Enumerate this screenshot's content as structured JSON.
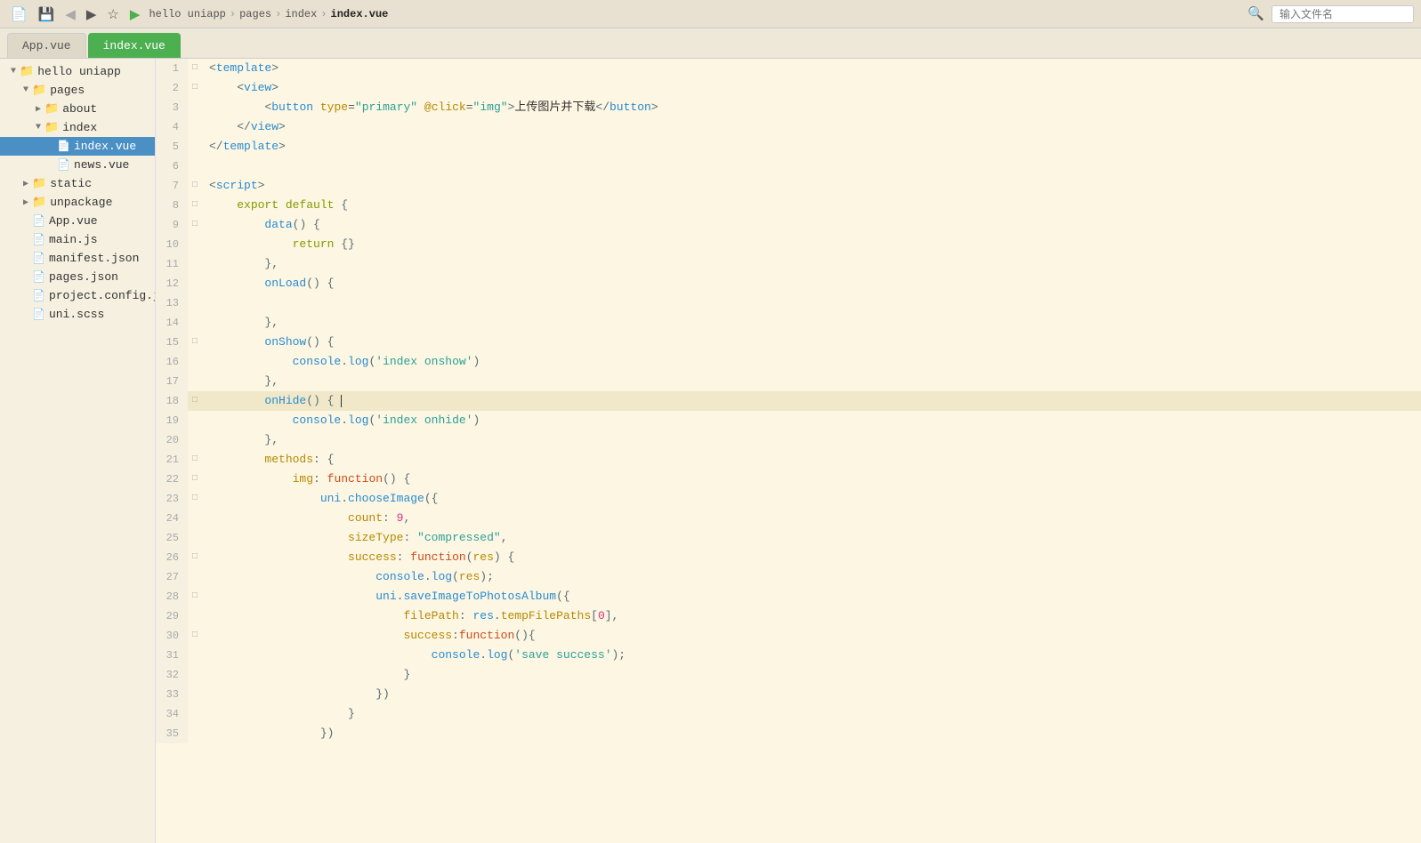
{
  "titlebar": {
    "breadcrumb": [
      "hello uniapp",
      "pages",
      "index",
      "index.vue"
    ],
    "search_placeholder": "输入文件名"
  },
  "tabs": [
    {
      "label": "App.vue",
      "active": false
    },
    {
      "label": "index.vue",
      "active": true
    }
  ],
  "sidebar": {
    "project": "hello uniapp",
    "tree": [
      {
        "id": "hello-uniapp",
        "label": "hello uniapp",
        "type": "project",
        "level": 0,
        "open": true
      },
      {
        "id": "pages",
        "label": "pages",
        "type": "folder",
        "level": 1,
        "open": true
      },
      {
        "id": "about",
        "label": "about",
        "type": "folder",
        "level": 2,
        "open": false
      },
      {
        "id": "index",
        "label": "index",
        "type": "folder",
        "level": 2,
        "open": true
      },
      {
        "id": "index-vue",
        "label": "index.vue",
        "type": "vue",
        "level": 3,
        "selected": true
      },
      {
        "id": "news-vue",
        "label": "news.vue",
        "type": "vue",
        "level": 3
      },
      {
        "id": "static",
        "label": "static",
        "type": "folder",
        "level": 1,
        "open": false
      },
      {
        "id": "unpackage",
        "label": "unpackage",
        "type": "folder",
        "level": 1,
        "open": false
      },
      {
        "id": "app-vue",
        "label": "App.vue",
        "type": "vue",
        "level": 1
      },
      {
        "id": "main-js",
        "label": "main.js",
        "type": "js",
        "level": 1
      },
      {
        "id": "manifest-json",
        "label": "manifest.json",
        "type": "json",
        "level": 1
      },
      {
        "id": "pages-json",
        "label": "pages.json",
        "type": "json-txt",
        "level": 1
      },
      {
        "id": "project-config",
        "label": "project.config.json",
        "type": "json-txt",
        "level": 1
      },
      {
        "id": "uni-css",
        "label": "uni.scss",
        "type": "css",
        "level": 1
      }
    ]
  },
  "code": {
    "lines": [
      {
        "num": 1,
        "fold": "open",
        "content": "<template>"
      },
      {
        "num": 2,
        "fold": "open",
        "content": "    <view>"
      },
      {
        "num": 3,
        "fold": "",
        "content": "        <button type=\"primary\" @click=\"img\">上传图片并下载</button>"
      },
      {
        "num": 4,
        "fold": "",
        "content": "    </view>"
      },
      {
        "num": 5,
        "fold": "",
        "content": "</template>"
      },
      {
        "num": 6,
        "fold": "",
        "content": ""
      },
      {
        "num": 7,
        "fold": "open",
        "content": "<script>"
      },
      {
        "num": 8,
        "fold": "open",
        "content": "    export default {"
      },
      {
        "num": 9,
        "fold": "open",
        "content": "        data() {"
      },
      {
        "num": 10,
        "fold": "",
        "content": "            return {}"
      },
      {
        "num": 11,
        "fold": "",
        "content": "        },"
      },
      {
        "num": 12,
        "fold": "",
        "content": "        onLoad() {"
      },
      {
        "num": 13,
        "fold": "",
        "content": ""
      },
      {
        "num": 14,
        "fold": "",
        "content": "        },"
      },
      {
        "num": 15,
        "fold": "open",
        "content": "        onShow() {"
      },
      {
        "num": 16,
        "fold": "",
        "content": "            console.log('index onshow')"
      },
      {
        "num": 17,
        "fold": "",
        "content": "        },"
      },
      {
        "num": 18,
        "fold": "open",
        "content": "        onHide() { ",
        "highlighted": true,
        "cursor": true
      },
      {
        "num": 19,
        "fold": "",
        "content": "            console.log('index onhide')"
      },
      {
        "num": 20,
        "fold": "",
        "content": "        },"
      },
      {
        "num": 21,
        "fold": "open",
        "content": "        methods: {"
      },
      {
        "num": 22,
        "fold": "open",
        "content": "            img: function() {"
      },
      {
        "num": 23,
        "fold": "open",
        "content": "                uni.chooseImage({"
      },
      {
        "num": 24,
        "fold": "",
        "content": "                    count: 9,"
      },
      {
        "num": 25,
        "fold": "",
        "content": "                    sizeType: \"compressed\","
      },
      {
        "num": 26,
        "fold": "open",
        "content": "                    success: function(res) {"
      },
      {
        "num": 27,
        "fold": "",
        "content": "                        console.log(res);"
      },
      {
        "num": 28,
        "fold": "open",
        "content": "                        uni.saveImageToPhotosAlbum({"
      },
      {
        "num": 29,
        "fold": "",
        "content": "                            filePath: res.tempFilePaths[0],"
      },
      {
        "num": 30,
        "fold": "open",
        "content": "                            success:function(){"
      },
      {
        "num": 31,
        "fold": "",
        "content": "                                console.log('save success');"
      },
      {
        "num": 32,
        "fold": "",
        "content": "                            }"
      },
      {
        "num": 33,
        "fold": "",
        "content": "                        })"
      },
      {
        "num": 34,
        "fold": "",
        "content": "                    }"
      },
      {
        "num": 35,
        "fold": "",
        "content": "                })"
      }
    ]
  }
}
